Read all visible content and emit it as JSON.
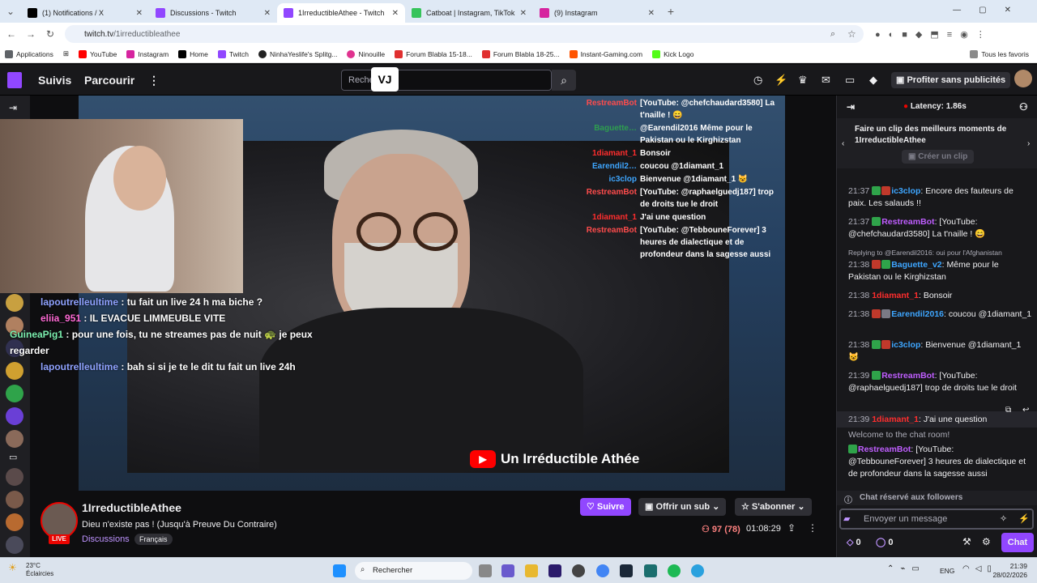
{
  "browser": {
    "tabs": [
      {
        "title": "(1) Notifications / X",
        "color": "#000000"
      },
      {
        "title": "Discussions - Twitch",
        "color": "#9147ff"
      },
      {
        "title": "1IrreductibleAthee - Twitch",
        "color": "#9147ff"
      },
      {
        "title": "Catboat | Instagram, TikTok, Tw",
        "color": "#36c45b"
      },
      {
        "title": "(9) Instagram",
        "color": "#d6249f"
      }
    ],
    "url_host": "twitch.tv",
    "url_path": "/1irreductibleathee",
    "bookmarks": [
      {
        "label": "Applications",
        "color": "#5f6368"
      },
      {
        "label": "YouTube",
        "color": "#ff0000"
      },
      {
        "label": "Instagram",
        "color": "#d6249f"
      },
      {
        "label": "Home",
        "color": "#000000"
      },
      {
        "label": "Twitch",
        "color": "#9147ff"
      },
      {
        "label": "NinhaYeslife's Splitg...",
        "color": "#222222"
      },
      {
        "label": "Ninouille",
        "color": "#e0338f"
      },
      {
        "label": "Forum Blabla 15-18...",
        "color": "#e03030"
      },
      {
        "label": "Forum Blabla 18-25...",
        "color": "#e03030"
      },
      {
        "label": "Instant-Gaming.com",
        "color": "#ff5400"
      },
      {
        "label": "Kick Logo",
        "color": "#53fc18"
      }
    ],
    "all_bookmarks": "Tous les favoris"
  },
  "twitch": {
    "nav": {
      "following": "Suivis",
      "browse": "Parcourir",
      "search_placeholder": "Rechercher",
      "ad_free": "Profiter sans publicités"
    },
    "overlay_chat_right": [
      {
        "name": "RestreamBot",
        "color": "#ff4c4c",
        "text": "[YouTube: @chefchaudard3580] La t'naille ! 😄"
      },
      {
        "name": "Baguette…",
        "color": "#2e9e4f",
        "text": "@Earendil2016 Même pour le Pakistan ou le Kirghizstan"
      },
      {
        "name": "1diamant_1",
        "color": "#ff2d2d",
        "text": "Bonsoir"
      },
      {
        "name": "Earendil2…",
        "color": "#3ea6ff",
        "text": "coucou @1diamant_1"
      },
      {
        "name": "ic3clop",
        "color": "#3ea6ff",
        "text": "Bienvenue @1diamant_1 😺"
      },
      {
        "name": "RestreamBot",
        "color": "#ff4c4c",
        "text": "[YouTube: @raphaelguedj187] trop de droits tue le droit"
      },
      {
        "name": "1diamant_1",
        "color": "#ff2d2d",
        "text": "J'ai une question"
      },
      {
        "name": "RestreamBot",
        "color": "#ff4c4c",
        "text": "[YouTube: @TebbouneForever] 3 heures de dialectique et de profondeur dans la sagesse aussi"
      }
    ],
    "overlay_chat_left": [
      {
        "name": "lapoutrelleultime",
        "color": "#8fa2ff",
        "text": "tu fait un live 24 h ma biche ?"
      },
      {
        "name": "eliia_951",
        "color": "#ff6ad5",
        "text": "IL EVACUE LIMMEUBLE VITE"
      },
      {
        "name": "GuineaPig1",
        "color": "#7cf0b0",
        "text": "pour une fois, tu ne streames pas de nuit 🐢 je peux regarder"
      },
      {
        "name": "lapoutrelleultime",
        "color": "#8fa2ff",
        "text": "bah si si je te le dit tu fait un live 24h"
      }
    ],
    "youtube_brand": "Un Irréductible Athée",
    "channel": {
      "name": "1IrreductibleAthee",
      "title": "Dieu n'existe pas ! (Jusqu'à Preuve Du Contraire)",
      "category": "Discussions",
      "language": "Français",
      "live": "LIVE",
      "viewers": "97 (78)",
      "uptime": "01:08:29"
    },
    "buttons": {
      "follow": "Suivre",
      "sub": "Offrir un sub",
      "subscribe": "S'abonner"
    },
    "chat": {
      "latency": "Latency: 1.86s",
      "clip_prompt": "Faire un clip des meilleurs moments de 1IrreductibleAthee",
      "clip_button": "Créer un clip",
      "messages": [
        {
          "time": "21:37",
          "user": "ic3clop",
          "color": "#3ea6ff",
          "text": ": Encore des fauteurs de paix. Les salauds !!"
        },
        {
          "time": "21:37",
          "user": "RestreamBot",
          "color": "#bf5eff",
          "text": ": [YouTube: @chefchaudard3580] La t'naille ! 😄"
        },
        {
          "time": "21:38",
          "user": "Baguette_v2",
          "color": "#3ea6ff",
          "reply": "Replying to @Earendil2016: oui pour l'Afghanistan",
          "text": ": Même pour le Pakistan ou le Kirghizstan"
        },
        {
          "time": "21:38",
          "user": "1diamant_1",
          "color": "#ff2d2d",
          "text": ": Bonsoir"
        },
        {
          "time": "21:38",
          "user": "Earendil2016",
          "color": "#3ea6ff",
          "text": ": coucou @1diamant_1"
        },
        {
          "time": "21:38",
          "user": "ic3clop",
          "color": "#3ea6ff",
          "text": ": Bienvenue @1diamant_1 😺"
        },
        {
          "time": "21:39",
          "user": "RestreamBot",
          "color": "#bf5eff",
          "text": ": [YouTube: @raphaelguedj187] trop de droits tue le droit"
        },
        {
          "time": "21:39",
          "user": "1diamant_1",
          "color": "#ff2d2d",
          "text": ": J'ai une question"
        },
        {
          "time": "",
          "user": "",
          "color": "#adadb8",
          "text": "Welcome to the chat room!"
        },
        {
          "time": "",
          "user": "RestreamBot",
          "color": "#bf5eff",
          "text": ": [YouTube: @TebbouneForever] 3 heures de dialectique et de profondeur dans la sagesse aussi"
        }
      ],
      "followers_only": "Chat réservé aux followers",
      "input_placeholder": "Envoyer un message",
      "points": "0",
      "bits": "0",
      "chat_button": "Chat"
    }
  },
  "taskbar": {
    "weather_temp": "23°C",
    "weather_desc": "Éclaircies",
    "search": "Rechercher",
    "lang": "ENG",
    "time": "21:39",
    "date": "28/02/2026"
  }
}
